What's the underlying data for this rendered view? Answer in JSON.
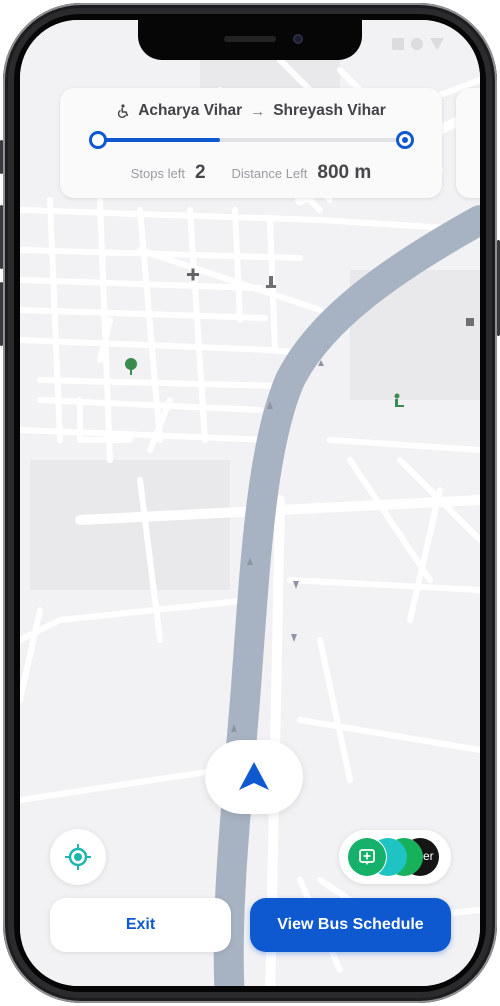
{
  "colors": {
    "accent": "#0e59cf",
    "map_background": "#f2f2f4",
    "map_road": "#ffffff",
    "route_line": "#a7b2c2"
  },
  "route": {
    "from": "Acharya Vihar",
    "to": "Shreyash Vihar",
    "progress_fraction": 0.4,
    "stops_label": "Stops left",
    "stops_value": "2",
    "distance_label": "Distance Left",
    "distance_value": "800 m",
    "icons": {
      "accessibility": "wheelchair-icon",
      "separator": "arrow-right-icon"
    }
  },
  "map": {
    "pois": [
      "hospital-icon",
      "monument-icon",
      "park-icon",
      "recreation-icon",
      "place-icon"
    ]
  },
  "apps_pill": {
    "icons": [
      "add-message-icon",
      "app-icon-teal",
      "app-icon-green",
      "app-icon-dark"
    ],
    "last_app_fragment": "er"
  },
  "controls": {
    "navigate_icon": "navigation-arrow-icon",
    "locate_icon": "my-location-icon"
  },
  "actions": {
    "exit_label": "Exit",
    "schedule_label": "View Bus Schedule"
  }
}
